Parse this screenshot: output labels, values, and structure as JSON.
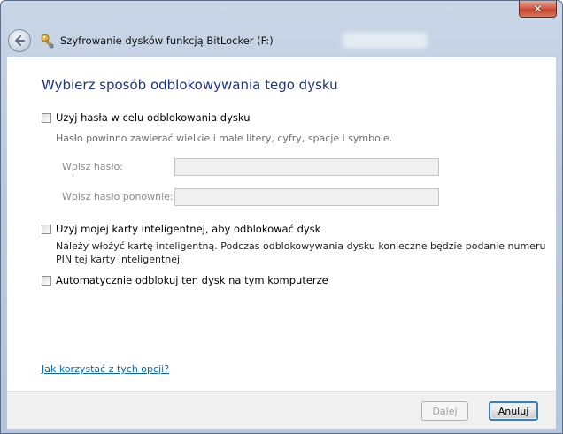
{
  "window": {
    "title": "Szyfrowanie dysków funkcją BitLocker (F:)",
    "close_label": "✕"
  },
  "page": {
    "heading": "Wybierz sposób odblokowywania tego dysku",
    "password_option": {
      "label": "Użyj hasła w celu odblokowania dysku",
      "checked": false,
      "note": "Hasło powinno zawierać wielkie i małe litery, cyfry, spacje i symbole.",
      "password_label": "Wpisz hasło:",
      "password_value": "",
      "confirm_label": "Wpisz hasło ponownie:",
      "confirm_value": ""
    },
    "smartcard_option": {
      "label": "Użyj mojej karty inteligentnej, aby odblokować dysk",
      "checked": false,
      "note_line1": "Należy włożyć kartę inteligentną. Podczas odblokowywania dysku konieczne będzie podanie numeru",
      "note_line2": "PIN tej karty inteligentnej."
    },
    "auto_option": {
      "label": "Automatycznie odblokuj ten dysk na tym komputerze",
      "checked": false
    },
    "help_link": "Jak korzystać z tych opcji?"
  },
  "footer": {
    "next_label": "Dalej",
    "cancel_label": "Anuluj"
  },
  "icons": {
    "back": "back-arrow-icon",
    "app": "key-icon",
    "close": "close-icon"
  },
  "colors": {
    "heading": "#1e3287",
    "link": "#0066cc"
  }
}
